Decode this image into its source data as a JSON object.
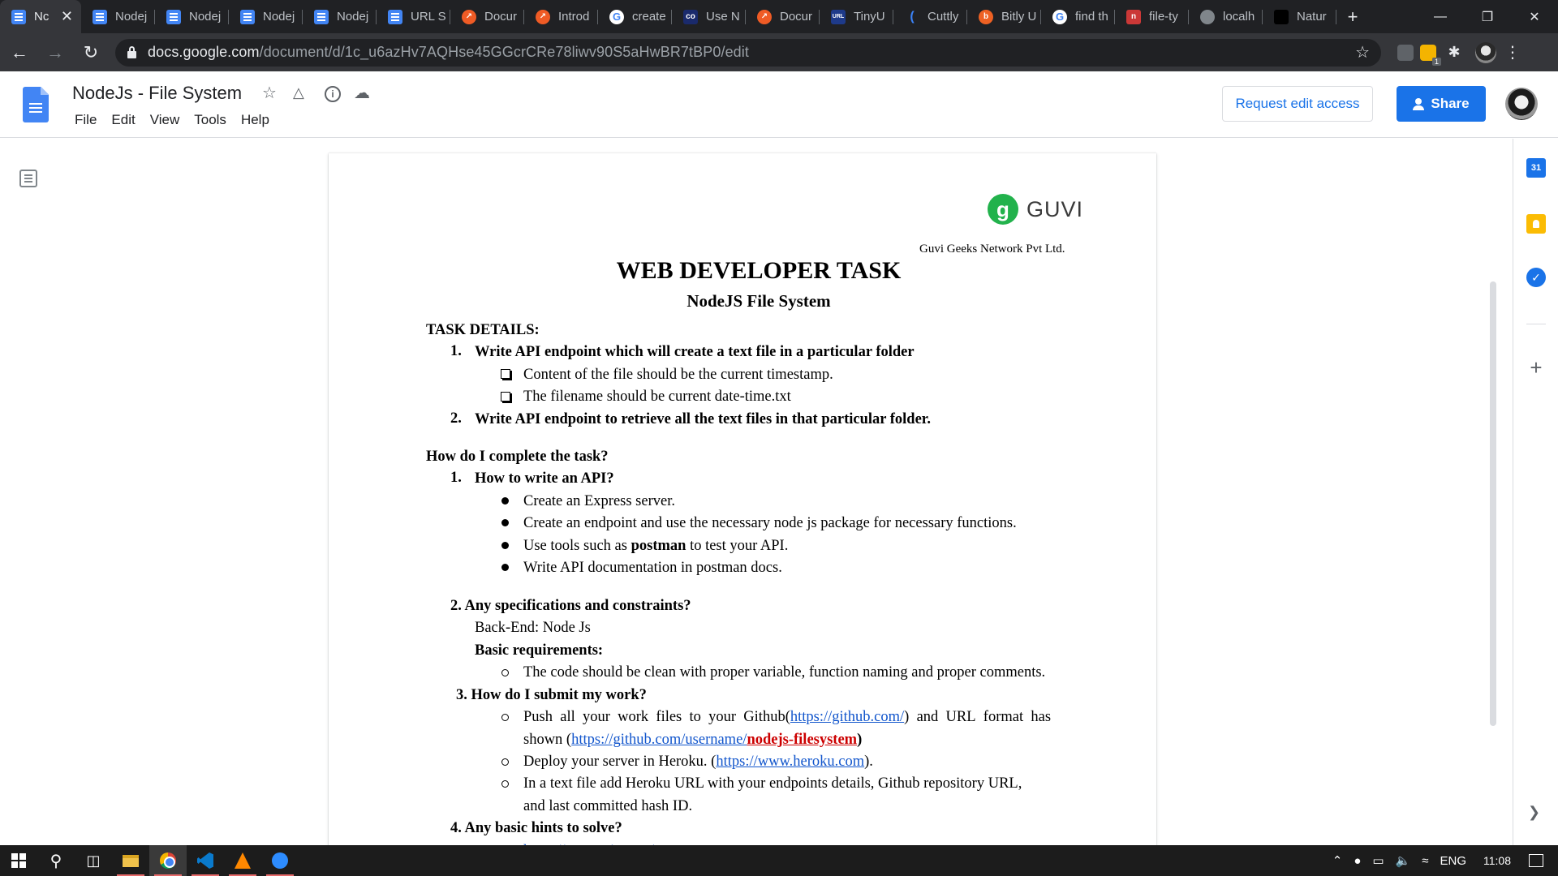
{
  "browser": {
    "tabs": [
      {
        "label": "N‎c",
        "icon": "docs",
        "active": true
      },
      {
        "label": "Nodej",
        "icon": "docs"
      },
      {
        "label": "Nodej",
        "icon": "docs"
      },
      {
        "label": "Nodej",
        "icon": "docs"
      },
      {
        "label": "Nodej",
        "icon": "docs"
      },
      {
        "label": "URL S",
        "icon": "docs"
      },
      {
        "label": "Docur",
        "icon": "postman"
      },
      {
        "label": "Introd",
        "icon": "postman"
      },
      {
        "label": "create",
        "icon": "google"
      },
      {
        "label": "Use N",
        "icon": "cc"
      },
      {
        "label": "Docur",
        "icon": "postman"
      },
      {
        "label": "TinyU",
        "icon": "tiny"
      },
      {
        "label": "Cuttly",
        "icon": "cuttly"
      },
      {
        "label": "Bitly U",
        "icon": "bitly"
      },
      {
        "label": "find th",
        "icon": "google"
      },
      {
        "label": "file-ty",
        "icon": "npm"
      },
      {
        "label": "localh",
        "icon": "local"
      },
      {
        "label": "Natur",
        "icon": "nature"
      }
    ],
    "new_tab": "+",
    "url_host": "docs.google.com",
    "url_path": "/document/d/1c_u6azHv7AQHse45GGcrCRe78liwv90S5aHwBR7tBP0/edit",
    "ext_badge": "1"
  },
  "docs": {
    "title": "NodeJs - File System",
    "menu": [
      "File",
      "Edit",
      "View",
      "Tools",
      "Help"
    ],
    "request_edit": "Request edit access",
    "share": "Share"
  },
  "document": {
    "logo_text": "GUVI",
    "logo_mark": "g",
    "company": "Guvi Geeks Network Pvt Ltd.",
    "title": "WEB DEVELOPER TASK",
    "subtitle": "NodeJS File System",
    "task_details_heading": "TASK DETAILS:",
    "task1_num": "1.",
    "task1": "Write API endpoint which will create a text file in a particular folder",
    "task1_sub1": "Content of the file should be the current timestamp.",
    "task1_sub2": "The filename should be current date-time.txt",
    "task2_num": "2.",
    "task2": "Write API endpoint to retrieve all the text files in that particular folder.",
    "how_heading": "How do I complete the task?",
    "q1_num": "1.",
    "q1": "How to write an API?",
    "q1_items": [
      "Create an Express server.",
      "Create an endpoint and use the necessary node js package for necessary functions.",
      "Use tools such as ",
      "Write API documentation in postman docs."
    ],
    "q1_bold_word": "postman",
    "q1_item3_tail": " to test your API.",
    "q2": "2. Any specifications and constraints?",
    "backend": "Back-End: Node Js",
    "basic_req": "Basic requirements:",
    "req1": "The code should be clean with proper variable, function naming and proper comments.",
    "q3": "3. How do I submit my work?",
    "submit1_a": "Push all your work files to your Github(",
    "github_link": "https://github.com/",
    "submit1_b": ") and URL format has",
    "submit1_c": "shown (",
    "github_user_link": "https://github.com/username/",
    "repo_name": "nodejs-filesystem",
    "submit1_d": ")",
    "submit2_a": "Deploy your server in Heroku. (",
    "heroku_link": "https://www.heroku.com",
    "submit2_b": ").",
    "submit3_a": "In a text file add Heroku URL with your endpoints details, Github repository URL,",
    "submit3_b": "and last committed hash ID.",
    "q4": "4. Any basic hints to solve?",
    "hint1": "https://expressjs.com/"
  },
  "side_panel": {
    "calendar_label": "31"
  },
  "taskbar": {
    "language": "ENG",
    "time": "11:08"
  },
  "icons": [
    "back-icon",
    "forward-icon",
    "reload-icon",
    "lock-icon",
    "star-icon",
    "puzzle-icon",
    "more-icon",
    "drive-icon",
    "info-icon",
    "cloud-icon",
    "outline-icon",
    "calendar-icon",
    "keep-icon",
    "tasks-icon",
    "add-icon"
  ]
}
